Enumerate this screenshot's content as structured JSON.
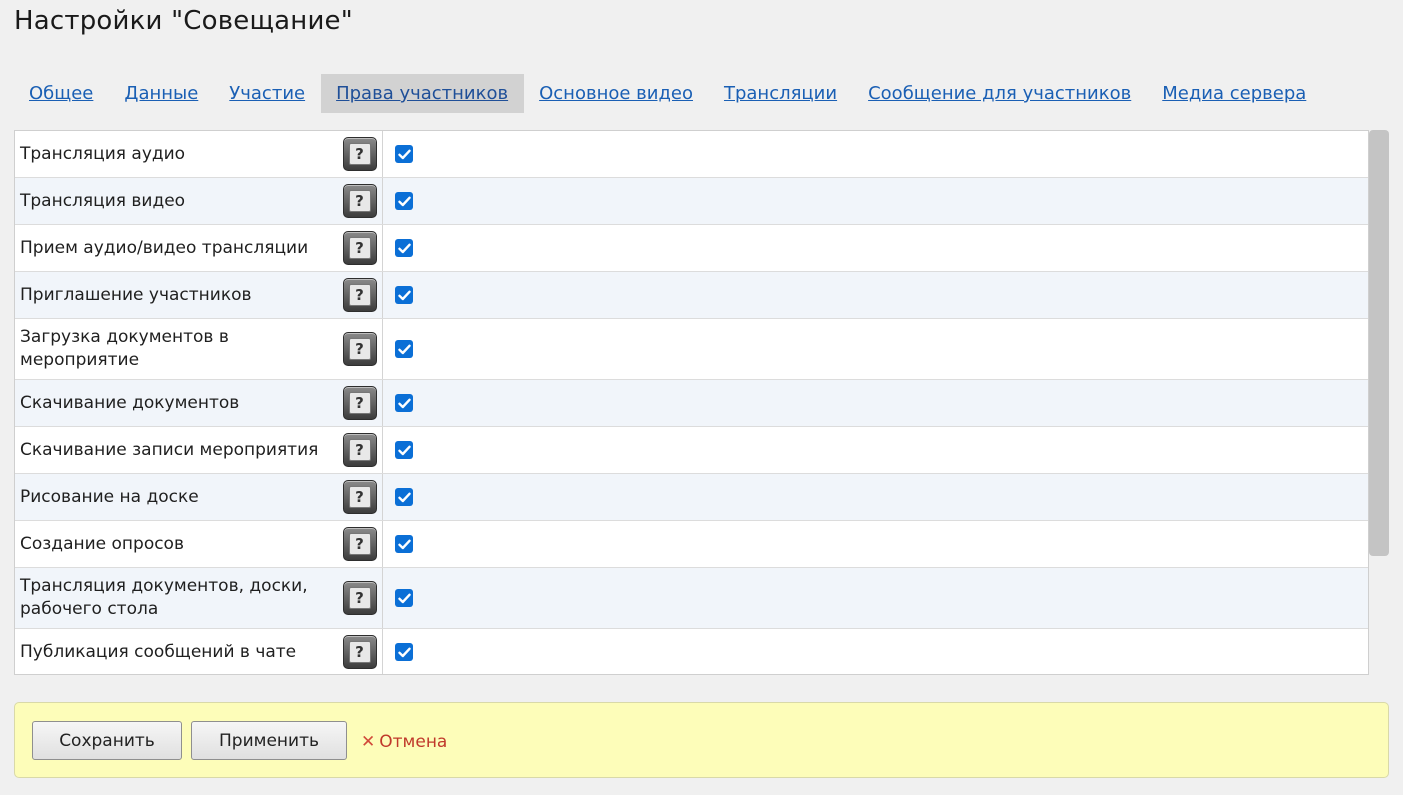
{
  "page_title": "Настройки \"Совещание\"",
  "tabs": [
    {
      "label": "Общее",
      "active": false
    },
    {
      "label": "Данные",
      "active": false
    },
    {
      "label": "Участие",
      "active": false
    },
    {
      "label": "Права участников",
      "active": true
    },
    {
      "label": "Основное видео",
      "active": false
    },
    {
      "label": "Трансляции",
      "active": false
    },
    {
      "label": "Сообщение для участников",
      "active": false
    },
    {
      "label": "Медиа сервера",
      "active": false
    }
  ],
  "permissions": [
    {
      "label": "Трансляция аудио",
      "checked": true
    },
    {
      "label": "Трансляция видео",
      "checked": true
    },
    {
      "label": "Прием аудио/видео трансляции",
      "checked": true
    },
    {
      "label": "Приглашение участников",
      "checked": true
    },
    {
      "label": "Загрузка документов в мероприятие",
      "checked": true
    },
    {
      "label": "Скачивание документов",
      "checked": true
    },
    {
      "label": "Скачивание записи мероприятия",
      "checked": true
    },
    {
      "label": "Рисование на доске",
      "checked": true
    },
    {
      "label": "Создание опросов",
      "checked": true
    },
    {
      "label": "Трансляция документов, доски, рабочего стола",
      "checked": true
    },
    {
      "label": "Публикация сообщений в чате",
      "checked": true
    }
  ],
  "help_glyph": "?",
  "footer": {
    "save_label": "Сохранить",
    "apply_label": "Применить",
    "cancel_label": "Отмена",
    "cancel_icon": "✕"
  },
  "colors": {
    "link": "#1a5fb4",
    "checkbox": "#0b6fd6",
    "footer_bg": "#fdfdb9",
    "cancel": "#c0392b"
  }
}
